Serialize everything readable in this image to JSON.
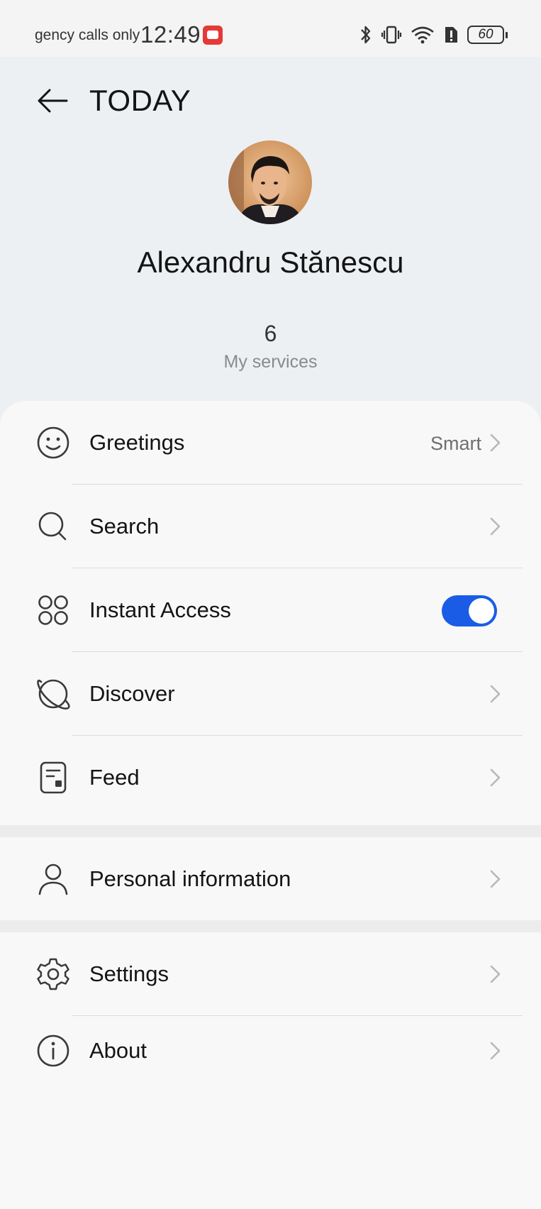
{
  "status_bar": {
    "carrier": "gency calls only",
    "time": "12:49",
    "battery": "60"
  },
  "header": {
    "title": "TODAY"
  },
  "profile": {
    "name": "Alexandru Stănescu",
    "services_count": "6",
    "services_label": "My services"
  },
  "menu": {
    "greetings": {
      "label": "Greetings",
      "value": "Smart",
      "icon": "smile-icon"
    },
    "search": {
      "label": "Search",
      "icon": "search-icon"
    },
    "instant_access": {
      "label": "Instant Access",
      "icon": "grid-circles-icon",
      "enabled": true
    },
    "discover": {
      "label": "Discover",
      "icon": "planet-icon"
    },
    "feed": {
      "label": "Feed",
      "icon": "feed-card-icon"
    },
    "personal_information": {
      "label": "Personal information",
      "icon": "person-icon"
    },
    "settings": {
      "label": "Settings",
      "icon": "gear-icon"
    },
    "about": {
      "label": "About",
      "icon": "info-icon"
    }
  },
  "colors": {
    "accent": "#1a5ce6",
    "header_bg": "#ecf0f3",
    "card_bg": "#f8f8f8",
    "notification": "#e53935"
  }
}
